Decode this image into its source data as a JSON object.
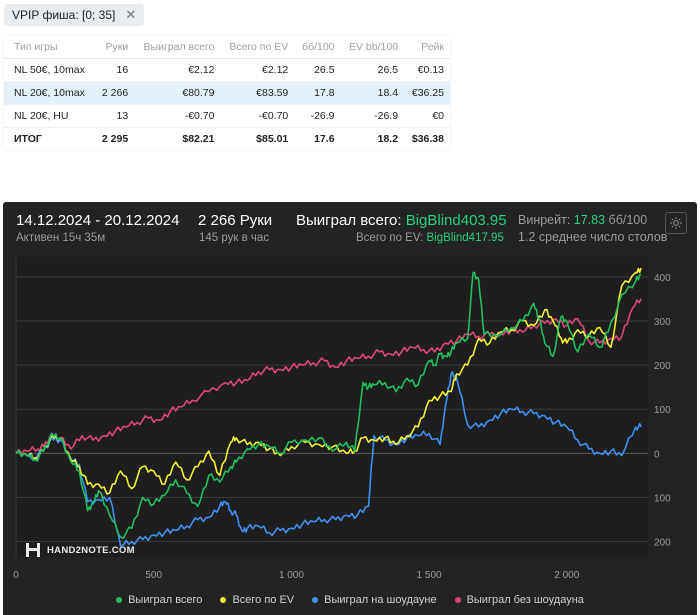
{
  "filter": {
    "label": "VPIP фиша: [0; 35]"
  },
  "table": {
    "headers": [
      "Тип игры",
      "Руки",
      "Выиграл всего",
      "Всего по EV",
      "бб/100",
      "EV bb/100",
      "Рейк"
    ],
    "rows": [
      [
        "NL 50€, 10max",
        "16",
        "€2.12",
        "€2.12",
        "26.5",
        "26.5",
        "€0.13"
      ],
      [
        "NL 20€, 10max",
        "2 266",
        "€80.79",
        "€83.59",
        "17.8",
        "18.4",
        "€36.25"
      ],
      [
        "NL 20€, HU",
        "13",
        "-€0.70",
        "-€0.70",
        "-26.9",
        "-26.9",
        "€0"
      ]
    ],
    "total": [
      "ИТОГ",
      "2 295",
      "$82.21",
      "$85.01",
      "17.6",
      "18.2",
      "$36.38"
    ]
  },
  "chart_header": {
    "dates": "14.12.2024 - 20.12.2024",
    "active": "Активен 15ч 35м",
    "hands": "2 266 Руки",
    "per_hour": "145 рук в час",
    "won_label": "Выиграл всего: ",
    "won_value": "BigBlind403.95",
    "ev_label": "Всего по EV: ",
    "ev_value": "BigBlind417.95",
    "winrate_label": "Винрейт: ",
    "winrate_value": "17.83",
    "winrate_unit": " бб/100",
    "tables": "1.2 среднее число столов"
  },
  "logo_text": "HAND2NOTE.COM",
  "colors": {
    "won": "#1fbf5f",
    "ev": "#f2f233",
    "showdown": "#3d8ff0",
    "nonshowdown": "#e0457a"
  },
  "chart_data": {
    "type": "line",
    "x_ticks": [
      "0",
      "500",
      "1 000",
      "1 500",
      "2 000"
    ],
    "x_tick_values": [
      0,
      500,
      1000,
      1500,
      2000
    ],
    "y_ticks": [
      "400",
      "300",
      "200",
      "100",
      "0",
      "100",
      "200"
    ],
    "y_tick_values": [
      400,
      300,
      200,
      100,
      0,
      -100,
      -200
    ],
    "xlim": [
      0,
      2295
    ],
    "ylim": [
      -235,
      445
    ],
    "series": [
      {
        "name": "Выиграл всего",
        "key": "won",
        "x": [
          0,
          40,
          70,
          100,
          130,
          160,
          200,
          230,
          260,
          280,
          300,
          340,
          380,
          420,
          460,
          500,
          540,
          580,
          620,
          660,
          700,
          740,
          780,
          800,
          840,
          880,
          920,
          960,
          1000,
          1050,
          1100,
          1150,
          1200,
          1230,
          1260,
          1280,
          1300,
          1340,
          1380,
          1420,
          1460,
          1500,
          1520,
          1540,
          1560,
          1580,
          1600,
          1640,
          1660,
          1680,
          1700,
          1750,
          1800,
          1840,
          1880,
          1900,
          1920,
          1950,
          1980,
          2000,
          2040,
          2080,
          2120,
          2150,
          2200,
          2250,
          2270
        ],
        "y": [
          0,
          -5,
          -15,
          5,
          45,
          35,
          -20,
          -40,
          -130,
          -110,
          -85,
          -140,
          -190,
          -170,
          -100,
          -115,
          -95,
          -60,
          -90,
          -120,
          -50,
          -65,
          -30,
          -20,
          10,
          20,
          15,
          0,
          25,
          30,
          35,
          5,
          25,
          5,
          160,
          150,
          155,
          160,
          140,
          170,
          155,
          210,
          200,
          225,
          220,
          230,
          250,
          260,
          410,
          395,
          270,
          265,
          285,
          300,
          340,
          305,
          250,
          220,
          310,
          300,
          230,
          270,
          240,
          275,
          360,
          390,
          405
        ]
      },
      {
        "name": "Всего по EV",
        "key": "ev",
        "x": [
          0,
          40,
          70,
          100,
          130,
          160,
          200,
          230,
          260,
          300,
          340,
          380,
          420,
          460,
          500,
          540,
          580,
          620,
          660,
          700,
          740,
          780,
          800,
          840,
          880,
          920,
          960,
          1000,
          1050,
          1100,
          1150,
          1200,
          1230,
          1260,
          1300,
          1340,
          1380,
          1420,
          1460,
          1500,
          1540,
          1580,
          1600,
          1640,
          1680,
          1720,
          1760,
          1800,
          1840,
          1880,
          1920,
          1950,
          1980,
          2000,
          2040,
          2080,
          2120,
          2160,
          2200,
          2250,
          2270
        ],
        "y": [
          0,
          -5,
          -10,
          5,
          40,
          35,
          -15,
          -30,
          -70,
          -70,
          -90,
          -40,
          -80,
          -30,
          -40,
          -70,
          -20,
          -60,
          -30,
          5,
          -50,
          25,
          35,
          20,
          25,
          10,
          -5,
          15,
          25,
          20,
          15,
          0,
          5,
          35,
          30,
          35,
          20,
          40,
          60,
          120,
          130,
          140,
          180,
          200,
          260,
          250,
          275,
          280,
          300,
          290,
          325,
          300,
          260,
          250,
          280,
          265,
          285,
          240,
          380,
          410,
          420
        ]
      },
      {
        "name": "Выиграл на шоудауне",
        "key": "showdown",
        "x": [
          0,
          40,
          60,
          100,
          130,
          160,
          200,
          230,
          260,
          300,
          340,
          380,
          420,
          460,
          500,
          540,
          580,
          620,
          660,
          700,
          740,
          760,
          780,
          800,
          820,
          840,
          880,
          920,
          960,
          1000,
          1040,
          1080,
          1120,
          1160,
          1200,
          1240,
          1280,
          1300,
          1340,
          1380,
          1420,
          1460,
          1500,
          1540,
          1560,
          1580,
          1600,
          1640,
          1680,
          1720,
          1760,
          1800,
          1840,
          1880,
          1920,
          1960,
          2000,
          2040,
          2080,
          2120,
          2160,
          2200,
          2250,
          2270
        ],
        "y": [
          0,
          -5,
          -10,
          5,
          35,
          30,
          -15,
          -25,
          -110,
          -105,
          -100,
          -210,
          -200,
          -195,
          -185,
          -180,
          -175,
          -165,
          -150,
          -145,
          -120,
          -110,
          -130,
          -140,
          -175,
          -170,
          -165,
          -180,
          -175,
          -170,
          -160,
          -155,
          -150,
          -150,
          -140,
          -140,
          -120,
          40,
          30,
          20,
          35,
          40,
          45,
          20,
          110,
          180,
          170,
          65,
          60,
          75,
          90,
          100,
          95,
          90,
          85,
          70,
          60,
          30,
          10,
          0,
          5,
          -5,
          60,
          60
        ]
      },
      {
        "name": "Выиграл без шоудауна",
        "key": "nonshowdown",
        "x": [
          0,
          40,
          80,
          100,
          130,
          160,
          200,
          240,
          280,
          320,
          360,
          400,
          440,
          480,
          520,
          560,
          600,
          640,
          700,
          760,
          800,
          840,
          880,
          920,
          960,
          1000,
          1040,
          1080,
          1120,
          1160,
          1200,
          1240,
          1280,
          1320,
          1360,
          1400,
          1440,
          1480,
          1520,
          1560,
          1600,
          1640,
          1680,
          1720,
          1760,
          1800,
          1840,
          1880,
          1920,
          1960,
          2000,
          2040,
          2080,
          2120,
          2160,
          2200,
          2240,
          2270
        ],
        "y": [
          0,
          5,
          10,
          15,
          45,
          35,
          10,
          40,
          30,
          40,
          50,
          60,
          70,
          80,
          75,
          95,
          105,
          120,
          140,
          160,
          160,
          165,
          185,
          190,
          190,
          195,
          200,
          205,
          210,
          195,
          210,
          215,
          220,
          230,
          225,
          230,
          240,
          235,
          230,
          250,
          255,
          270,
          265,
          270,
          270,
          280,
          275,
          290,
          295,
          305,
          290,
          305,
          255,
          250,
          260,
          265,
          330,
          350
        ]
      }
    ],
    "grid": true,
    "legend_position": "bottom"
  }
}
